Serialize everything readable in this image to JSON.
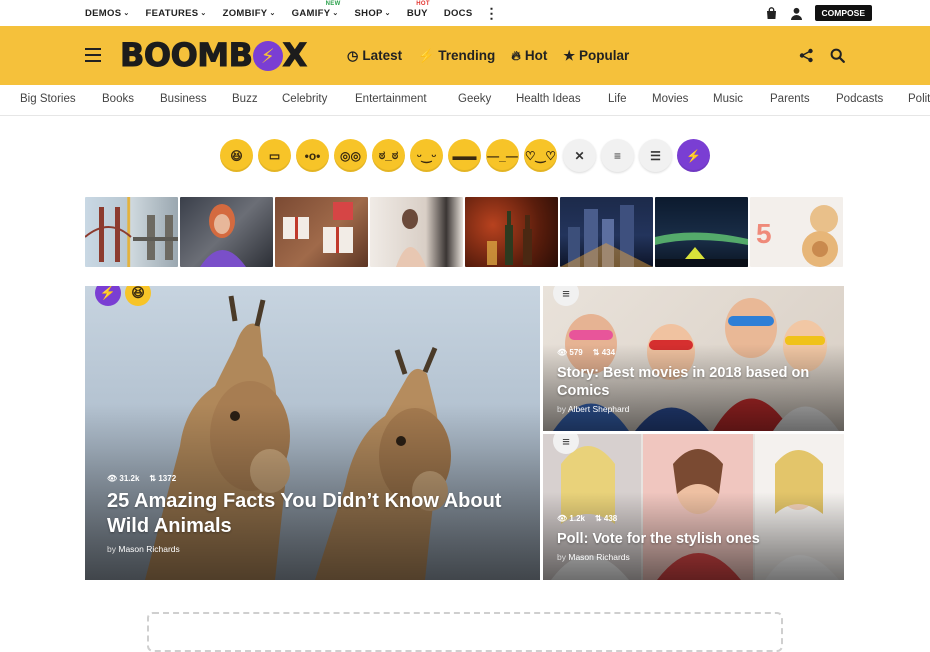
{
  "topnav": {
    "items": [
      {
        "label": "DEMOS",
        "caret": "⌄",
        "badge": ""
      },
      {
        "label": "FEATURES",
        "caret": "⌄",
        "badge": ""
      },
      {
        "label": "ZOMBIFY",
        "caret": "⌄",
        "badge": ""
      },
      {
        "label": "GAMIFY",
        "caret": "⌄",
        "badge": "NEW"
      },
      {
        "label": "SHOP",
        "caret": "⌄",
        "badge": ""
      },
      {
        "label": "BUY",
        "caret": "",
        "badge": "HOT"
      },
      {
        "label": "DOCS",
        "caret": "",
        "badge": ""
      }
    ],
    "more_icon": "⋮",
    "bag_icon": "shopping-bag-icon",
    "user_icon": "user-icon",
    "compose_label": "COMPOSE"
  },
  "header": {
    "logo": {
      "part1": "BOOMB",
      "bolt": "⚡",
      "part2": "X"
    },
    "nav": [
      {
        "icon": "◷",
        "label": "Latest"
      },
      {
        "icon": "⚡",
        "label": "Trending"
      },
      {
        "icon": "🔥︎",
        "label": "Hot"
      },
      {
        "icon": "★",
        "label": "Popular"
      }
    ],
    "share_icon": "share-icon",
    "search_icon": "search-icon",
    "bg_color": "#f5c13b"
  },
  "categories": [
    "Big Stories",
    "Books",
    "Business",
    "Buzz",
    "Celebrity",
    "Entertainment",
    "Geeky",
    "Health Ideas",
    "Life",
    "Movies",
    "Music",
    "Parents",
    "Podcasts",
    "Polit"
  ],
  "reactions": [
    {
      "name": "lol",
      "glyph": "😆︎"
    },
    {
      "name": "omg",
      "glyph": "▭"
    },
    {
      "name": "wow",
      "glyph": "•o•"
    },
    {
      "name": "geeky",
      "glyph": "◎◎"
    },
    {
      "name": "wtf",
      "glyph": "ಠ_ಠ"
    },
    {
      "name": "cute",
      "glyph": "ᵕ‿ᵕ"
    },
    {
      "name": "cool",
      "glyph": "▬▬"
    },
    {
      "name": "fail",
      "glyph": "—_—"
    },
    {
      "name": "love",
      "glyph": "♡‿♡"
    },
    {
      "name": "versus",
      "glyph": "✕"
    },
    {
      "name": "list",
      "glyph": "≡"
    },
    {
      "name": "ordered-list",
      "glyph": "☰"
    },
    {
      "name": "trending",
      "glyph": "⚡"
    }
  ],
  "featured": {
    "main": {
      "views": "31.2k",
      "votes": "1372",
      "title": "25 Amazing Facts You Didn’t Know About Wild Animals",
      "by": "by",
      "author": "Mason Richards",
      "badge1": "⚡",
      "badge2": "😆︎"
    },
    "story": {
      "views": "579",
      "votes": "434",
      "title": "Story: Best movies in 2018 based on Comics",
      "by": "by",
      "author": "Albert Shephard",
      "badge": "≡"
    },
    "poll": {
      "views": "1.2k",
      "votes": "438",
      "title": "Poll: Vote for the stylish ones",
      "by": "by",
      "author": "Mason Richards",
      "badge": "≡"
    }
  }
}
